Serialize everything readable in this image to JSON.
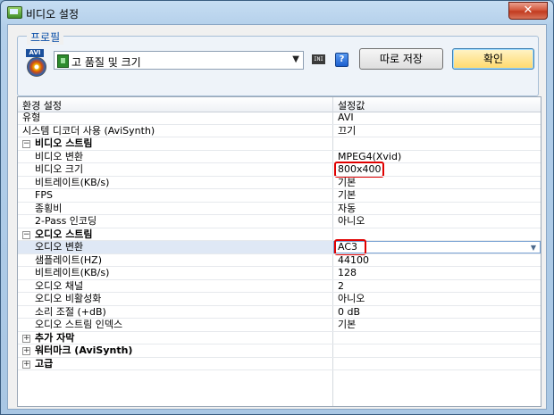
{
  "window": {
    "title": "비디오 설정",
    "close": "✕"
  },
  "profile": {
    "group_label": "프로필",
    "file_type_tag": "AVI",
    "selected_profile": "고 품질 및 크기",
    "ini_icon_text": "INI",
    "help_icon_text": "?",
    "save_as_label": "따로 저장",
    "ok_label": "확인"
  },
  "grid": {
    "header_setting": "환경 설정",
    "header_value": "설정값",
    "rows": [
      {
        "type": "item",
        "key": "유형",
        "value": "AVI"
      },
      {
        "type": "item",
        "key": "시스템 디코더 사용 (AviSynth)",
        "value": "끄기"
      },
      {
        "type": "category",
        "key": "비디오 스트림",
        "toggle": "−"
      },
      {
        "type": "item",
        "key": "비디오 변환",
        "value": "MPEG4(Xvid)",
        "indent": true
      },
      {
        "type": "item",
        "key": "비디오 크기",
        "value": "800x400",
        "indent": true,
        "highlight": true
      },
      {
        "type": "item",
        "key": "비트레이트(KB/s)",
        "value": "기본",
        "indent": true
      },
      {
        "type": "item",
        "key": "FPS",
        "value": "기본",
        "indent": true
      },
      {
        "type": "item",
        "key": "종횡비",
        "value": "자동",
        "indent": true
      },
      {
        "type": "item",
        "key": "2-Pass 인코딩",
        "value": "아니오",
        "indent": true
      },
      {
        "type": "category",
        "key": "오디오 스트림",
        "toggle": "−"
      },
      {
        "type": "item",
        "key": "오디오 변환",
        "value": "AC3",
        "indent": true,
        "highlight": true,
        "selected": true
      },
      {
        "type": "item",
        "key": "샘플레이트(HZ)",
        "value": "44100",
        "indent": true
      },
      {
        "type": "item",
        "key": "비트레이트(KB/s)",
        "value": "128",
        "indent": true
      },
      {
        "type": "item",
        "key": "오디오 채널",
        "value": "2",
        "indent": true
      },
      {
        "type": "item",
        "key": "오디오 비활성화",
        "value": "아니오",
        "indent": true
      },
      {
        "type": "item",
        "key": "소리 조절 (+dB)",
        "value": "0 dB",
        "indent": true
      },
      {
        "type": "item",
        "key": "오디오 스트림 인덱스",
        "value": "기본",
        "indent": true
      },
      {
        "type": "category",
        "key": "추가 자막",
        "toggle": "+"
      },
      {
        "type": "category",
        "key": "워터마크 (AviSynth)",
        "toggle": "+"
      },
      {
        "type": "category",
        "key": "고급",
        "toggle": "+"
      }
    ]
  }
}
